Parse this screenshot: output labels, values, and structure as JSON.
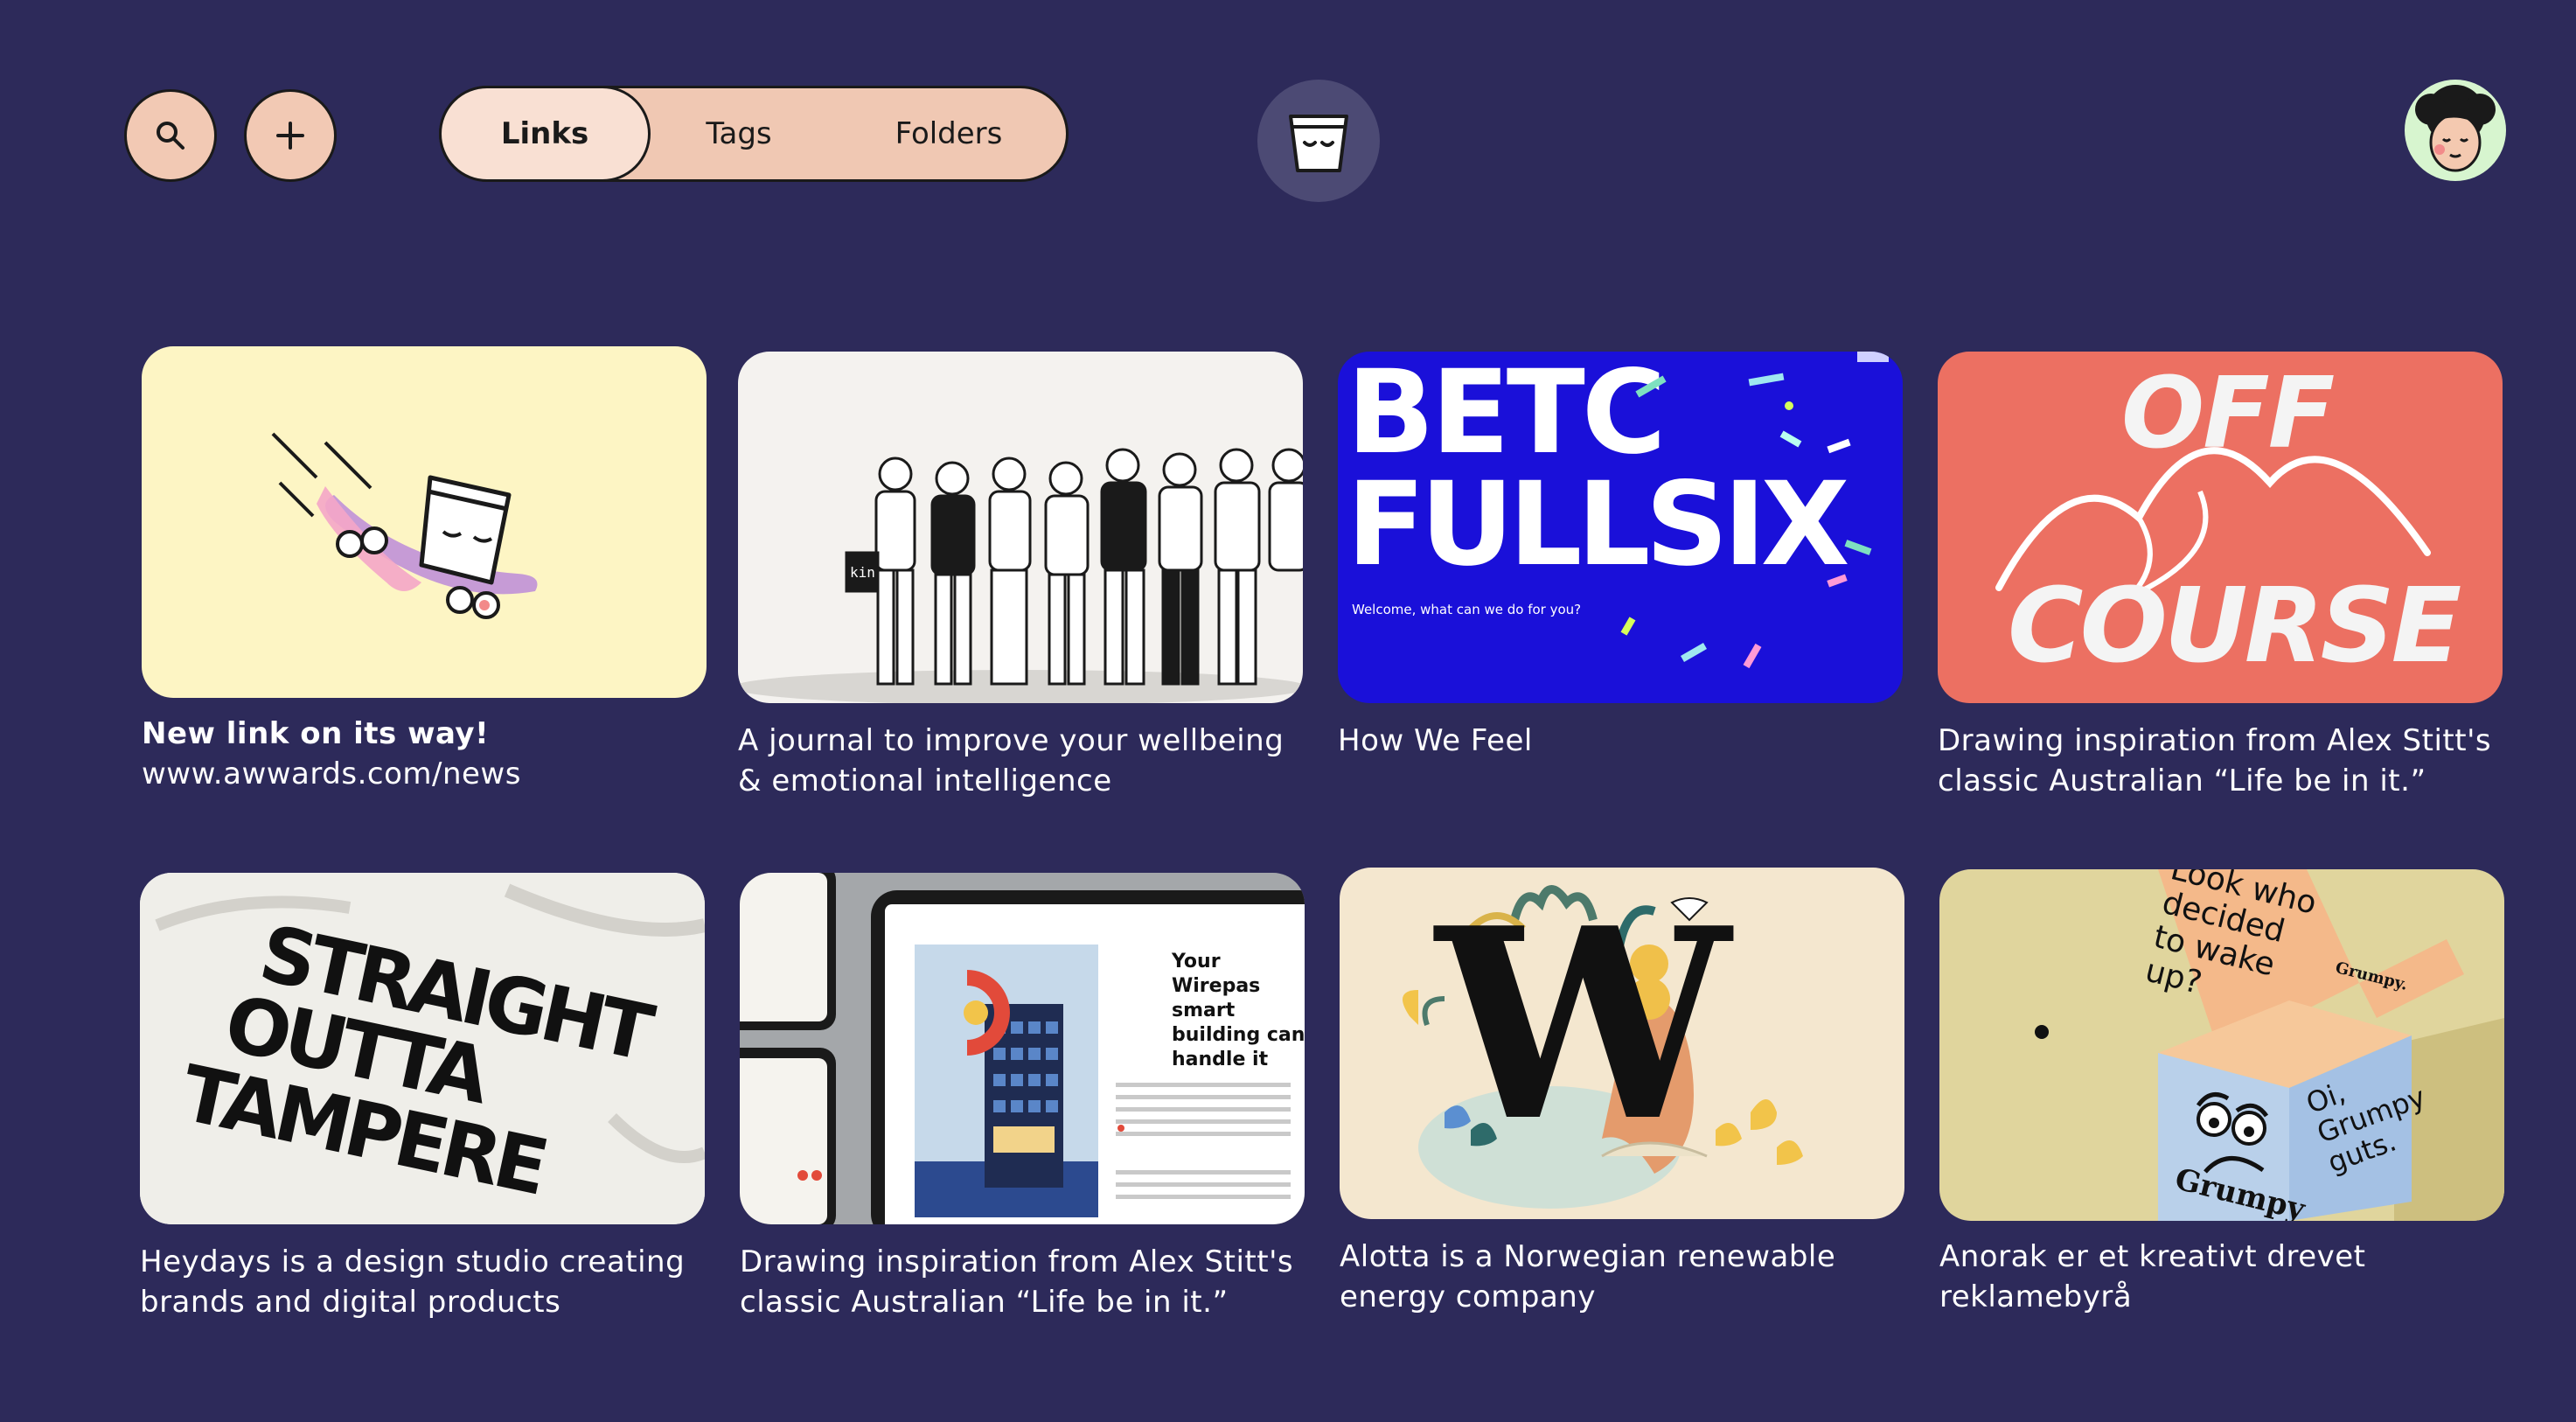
{
  "toolbar": {
    "search_icon": "search-icon",
    "add_icon": "plus-icon"
  },
  "tabs": [
    {
      "label": "Links",
      "active": true
    },
    {
      "label": "Tags",
      "active": false
    },
    {
      "label": "Folders",
      "active": false
    }
  ],
  "colors": {
    "background": "#2d2a5a",
    "pill": "#f0c8b3",
    "pill_active": "#f9e0d3"
  },
  "cards": [
    {
      "title": "New link on its way!",
      "url": "www.awwards.com/news"
    },
    {
      "caption": "A journal to improve your wellbeing & emotional intelligence"
    },
    {
      "caption": "How We Feel",
      "thumb_text": {
        "line1": "BETC",
        "line2": "FULLSIX",
        "welcome": "Welcome, what can we do for you?"
      }
    },
    {
      "caption": "Drawing inspiration from Alex Stitt's classic Australian “Life be in it.”",
      "thumb_text": {
        "line1": "OFF",
        "line2": "COURSE"
      }
    },
    {
      "caption": "Heydays is a design studio creating brands and digital products",
      "thumb_text": {
        "line1": "STRAIGHT",
        "line2": "OUTTA",
        "line3": "TAMPERE"
      }
    },
    {
      "caption": "Drawing inspiration from Alex Stitt's classic Australian “Life be in it.”",
      "thumb_text": {
        "heading": "Your Wirepas smart building can handle it"
      }
    },
    {
      "caption": "Alotta is a Norwegian renewable energy company",
      "thumb_text": {
        "letter": "W"
      }
    },
    {
      "caption": "Anorak er et kreativt drevet reklamebyrå",
      "thumb_text": {
        "box_top": "Look who decided to wake up?",
        "brand": "Grumpy.",
        "side": "Oi, Grumpy guts.",
        "front": "Grumpy"
      }
    }
  ]
}
